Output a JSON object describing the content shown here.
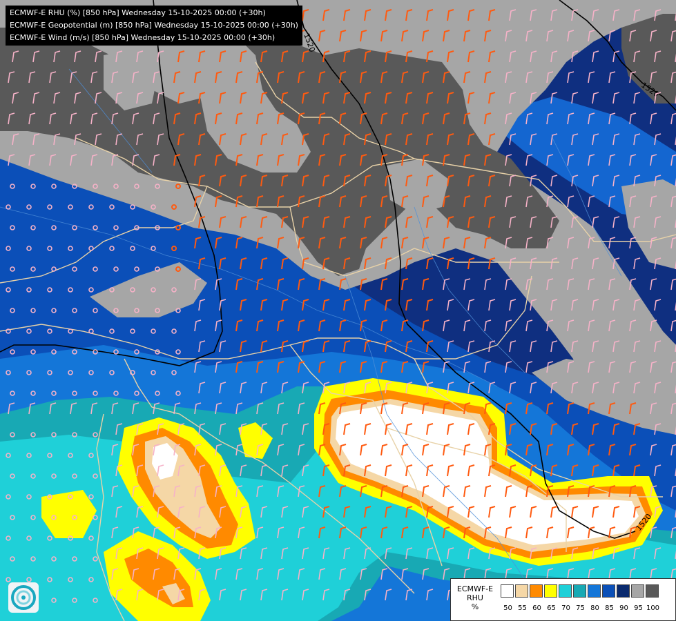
{
  "title_lines": [
    "ECMWF-E RHU (%) [850 hPa] Wednesday 15-10-2025 00:00 (+30h)",
    "ECMWF-E Geopotential (m) [850 hPa] Wednesday 15-10-2025 00:00 (+30h)",
    "ECMWF-E Wind (m/s) [850 hPa] Wednesday 15-10-2025 00:00 (+30h)"
  ],
  "contour_labels": [
    "1520",
    "1520",
    "1520"
  ],
  "legend": {
    "model": "ECMWF-E",
    "variable": "RHU",
    "unit": "%",
    "ticks": [
      "50",
      "55",
      "60",
      "65",
      "70",
      "75",
      "80",
      "85",
      "90",
      "95",
      "100"
    ],
    "colors": [
      "#ffffff",
      "#f5d7a6",
      "#ff8a00",
      "#ffff00",
      "#1fd0d8",
      "#18a9b4",
      "#1476d8",
      "#0b50b8",
      "#0a2a6e",
      "#a6a6a6",
      "#595959"
    ]
  },
  "logo_icon": "ecmwf-logo-icon",
  "colors": {
    "very_dry": "#ffffff",
    "dry": "#f5d7a6",
    "orange": "#ff8a00",
    "yellow": "#ffff00",
    "cyan": "#1fd0d8",
    "teal": "#18a9b4",
    "blue": "#1476d8",
    "mid_blue": "#0b50b8",
    "navy": "#0a2a6e",
    "light_gray": "#a6a6a6",
    "dark_gray": "#595959",
    "border": "#e8d2a8",
    "wind_pink": "#f6b2c8",
    "wind_orange": "#ff5a10",
    "wind_red": "#e01020",
    "contour": "#000000"
  }
}
